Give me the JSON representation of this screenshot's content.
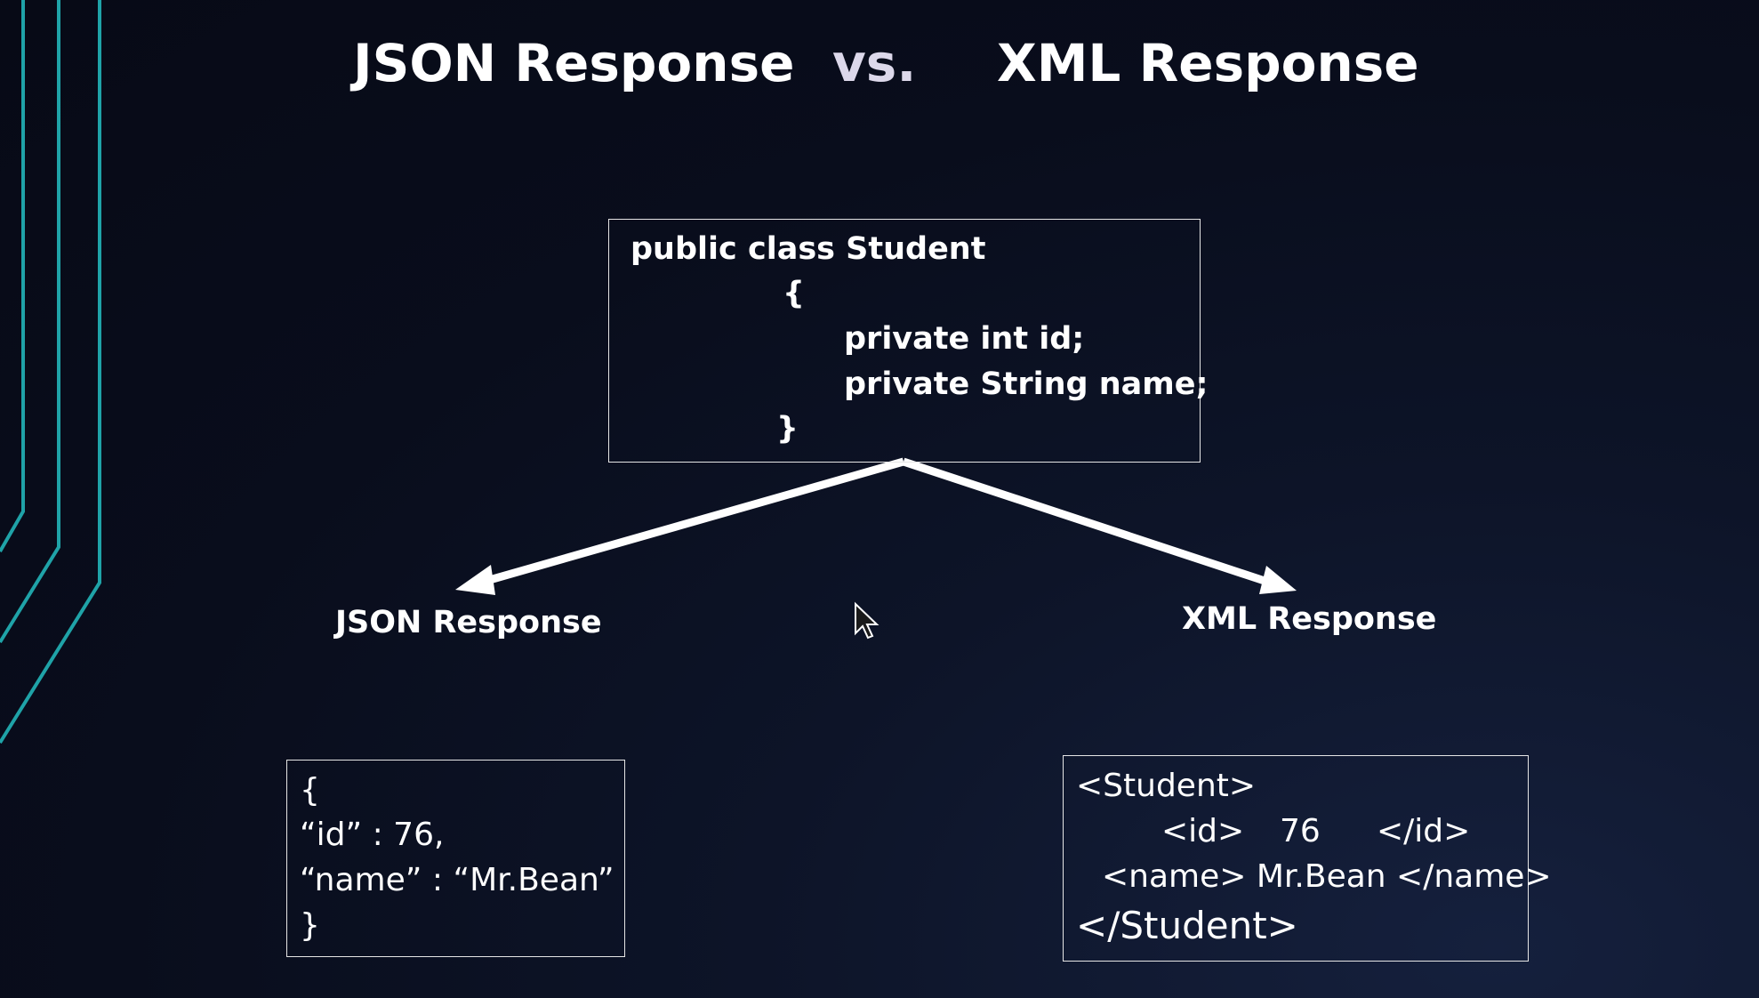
{
  "title": {
    "left": "JSON Response",
    "vs": "vs.",
    "right": "XML Response"
  },
  "class_box": {
    "lines": [
      "public  class  Student",
      "{",
      "private  int  id;",
      "private  String  name;",
      "}"
    ]
  },
  "labels": {
    "json": "JSON Response",
    "xml": "XML Response"
  },
  "json_box": {
    "lines": [
      "{",
      "“id” : 76,",
      "“name” : “Mr.Bean”",
      "}"
    ]
  },
  "xml_box": {
    "lines": [
      "<Student>",
      "<id>",
      "76",
      "</id>",
      "<name> Mr.Bean </name>",
      "</Student>"
    ]
  },
  "colors": {
    "accent_lines": "#1fa3a8",
    "box_border": "#e6e6e6",
    "text": "#ffffff"
  },
  "icons": {
    "cursor": "mouse-pointer-icon"
  }
}
